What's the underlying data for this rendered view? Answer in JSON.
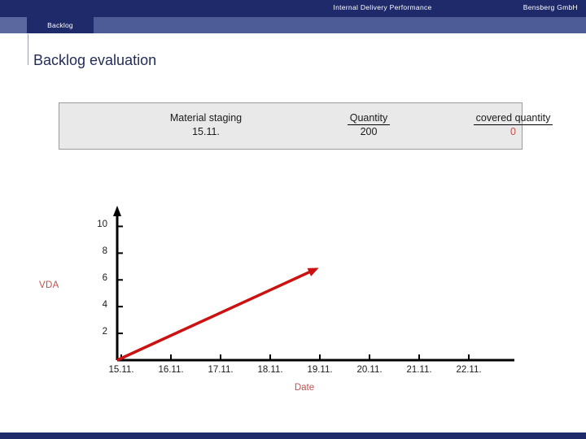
{
  "header": {
    "title": "Internal Delivery Performance",
    "company": "Bensberg GmbH",
    "band_color": "#1f2a6b",
    "sub_band_color": "#4d5c96"
  },
  "tabs": [
    {
      "label": "Backlog",
      "active": true
    }
  ],
  "page": {
    "title": "Backlog evaluation"
  },
  "info_panel": {
    "columns": [
      {
        "head": "Material staging",
        "value": "15.11.",
        "underlined": false,
        "value_color": "#1a1a1a"
      },
      {
        "head": "Quantity",
        "value": "200",
        "underlined": true,
        "value_color": "#1a1a1a"
      },
      {
        "head": "covered quantity",
        "value": "0",
        "underlined": true,
        "value_color": "#c0504d"
      }
    ]
  },
  "chart_data": {
    "type": "line",
    "title": "",
    "xlabel": "Date",
    "ylabel": "VDA",
    "categories": [
      "15.11.",
      "16.11.",
      "17.11.",
      "18.11.",
      "19.11.",
      "20.11.",
      "21.11.",
      "22.11."
    ],
    "yticks": [
      2,
      4,
      6,
      8,
      10
    ],
    "ylim": [
      0,
      11
    ],
    "grid": false,
    "legend": null,
    "series": [
      {
        "name": "VDA",
        "color": "#cc1111",
        "arrow_end": true,
        "x": [
          "15.11.",
          "16.11.",
          "17.11.",
          "18.11.",
          "19.11."
        ],
        "values": [
          0,
          1.7,
          3.4,
          5.1,
          6.8
        ]
      }
    ],
    "axis_color": "#000000"
  },
  "footer": {
    "bar_color": "#1f2a6b"
  }
}
